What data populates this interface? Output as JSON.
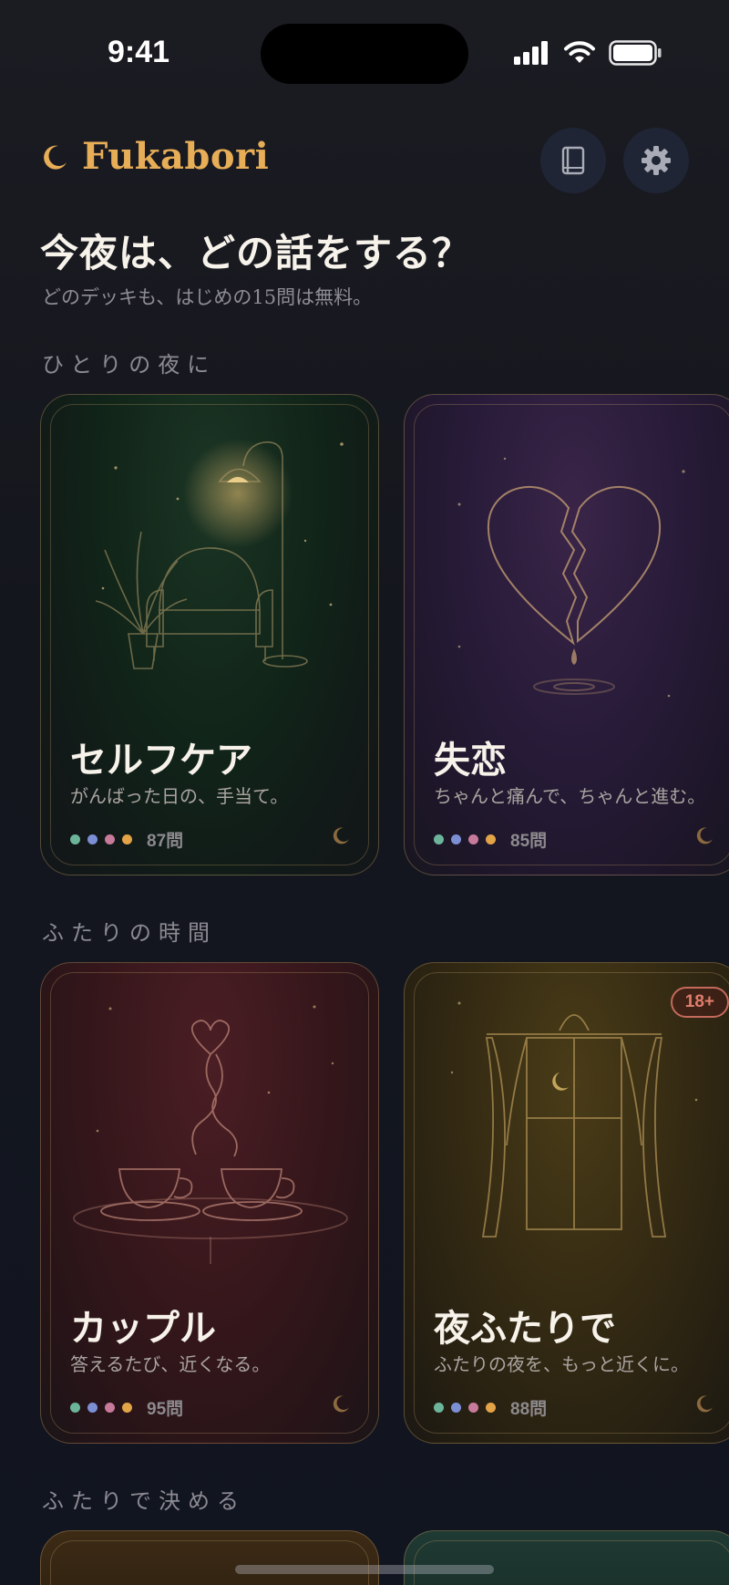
{
  "status_bar": {
    "time": "9:41"
  },
  "header": {
    "brand": "Fukabori",
    "accent_color": "#e7ad57",
    "icons": [
      "moon-icon",
      "book-icon",
      "gear-icon"
    ]
  },
  "intro": {
    "title": "今夜は、どの話をする？",
    "subtitle": "どのデッキも、はじめの15問は無料。"
  },
  "sections": [
    {
      "label": "ひとりの夜に",
      "decks": [
        {
          "title": "セルフケア",
          "subtitle": "がんばった日の、手当て。",
          "count": "87問"
        },
        {
          "title": "失恋",
          "subtitle": "ちゃんと痛んで、ちゃんと進む。",
          "count": "85問"
        }
      ]
    },
    {
      "label": "ふたりの時間",
      "decks": [
        {
          "title": "カップル",
          "subtitle": "答えるたび、近くなる。",
          "count": "95問"
        },
        {
          "title": "夜ふたりで",
          "subtitle": "ふたりの夜を、もっと近くに。",
          "count": "88問",
          "badge": "18+"
        }
      ]
    },
    {
      "label": "ふたりで決める"
    }
  ],
  "dot_colors": [
    "#6cb59b",
    "#7d8fd4",
    "#c77a9a",
    "#e3a347"
  ]
}
